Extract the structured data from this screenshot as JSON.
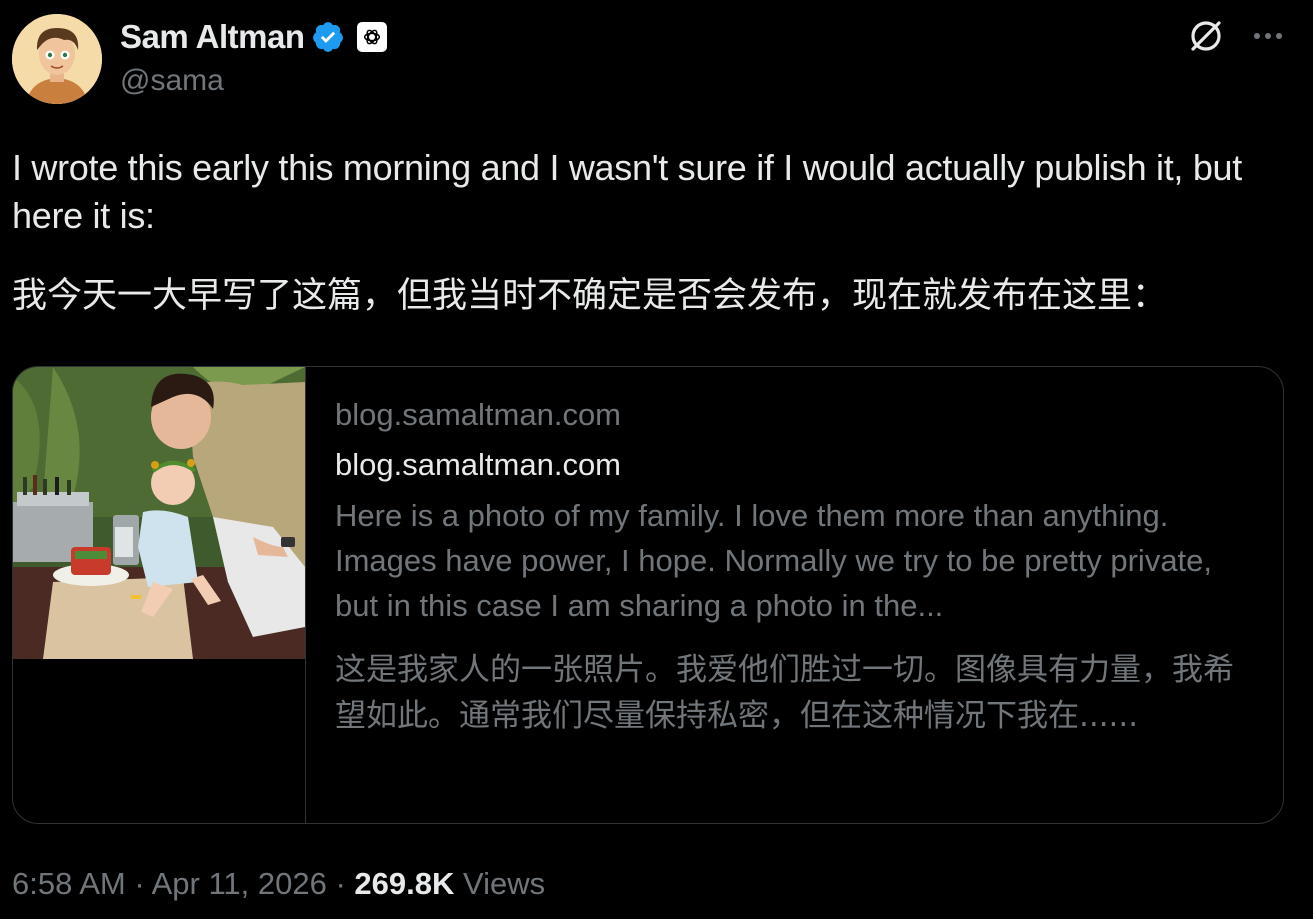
{
  "author": {
    "display_name": "Sam Altman",
    "handle": "@sama",
    "avatar_icon": "cartoon-avatar",
    "verified_icon": "verified-badge-icon",
    "affiliate_icon": "openai-logo-icon"
  },
  "header_actions": {
    "grok_icon": "grok-icon",
    "more_icon": "more-options-icon"
  },
  "tweet": {
    "text_en": "I wrote this early this morning and I wasn't sure if I would actually publish it, but here it is:",
    "text_zh": "我今天一大早写了这篇，但我当时不确定是否会发布，现在就发布在这里："
  },
  "link_card": {
    "domain": "blog.samaltman.com",
    "title": "blog.samaltman.com",
    "description": "Here is a photo of my family. I love them more than anything. Images have power, I hope. Normally we try to be pretty private, but in this case I am sharing a photo in the...",
    "description_zh": "这是我家人的一张照片。我爱他们胜过一切。图像具有力量，我希望如此。通常我们尽量保持私密，但在这种情况下我在......"
  },
  "meta": {
    "time": "6:58 AM",
    "separator": "·",
    "date": "Apr 11, 2026",
    "views_count": "269.8K",
    "views_label": "Views"
  },
  "colors": {
    "background": "#000000",
    "text_primary": "#e7e9ea",
    "text_secondary": "#71767b",
    "border": "#2f3336",
    "verified_blue": "#1d9bf0"
  }
}
